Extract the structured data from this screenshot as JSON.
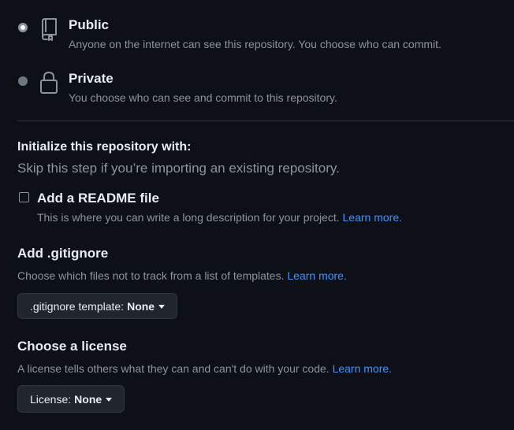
{
  "visibility": {
    "public": {
      "title": "Public",
      "description": "Anyone on the internet can see this repository. You choose who can commit.",
      "icon": "repo-icon",
      "selected": true
    },
    "private": {
      "title": "Private",
      "description": "You choose who can see and commit to this repository.",
      "icon": "lock-icon",
      "selected": false
    }
  },
  "initialize": {
    "title": "Initialize this repository with:",
    "subtitle": "Skip this step if you’re importing an existing repository.",
    "readme": {
      "label": "Add a README file",
      "description": "This is where you can write a long description for your project.",
      "link": "Learn more.",
      "checked": false
    }
  },
  "gitignore": {
    "title": "Add .gitignore",
    "description": "Choose which files not to track from a list of templates.",
    "link": "Learn more.",
    "dropdown_label": ".gitignore template:",
    "dropdown_value": "None"
  },
  "license": {
    "title": "Choose a license",
    "description": "A license tells others what they can and can't do with your code.",
    "link": "Learn more.",
    "dropdown_label": "License:",
    "dropdown_value": "None"
  },
  "colors": {
    "background": "#0d1117",
    "text": "#e6edf3",
    "muted": "#8b949e",
    "link": "#4493f8",
    "border": "#30363d",
    "button": "#21262d"
  }
}
